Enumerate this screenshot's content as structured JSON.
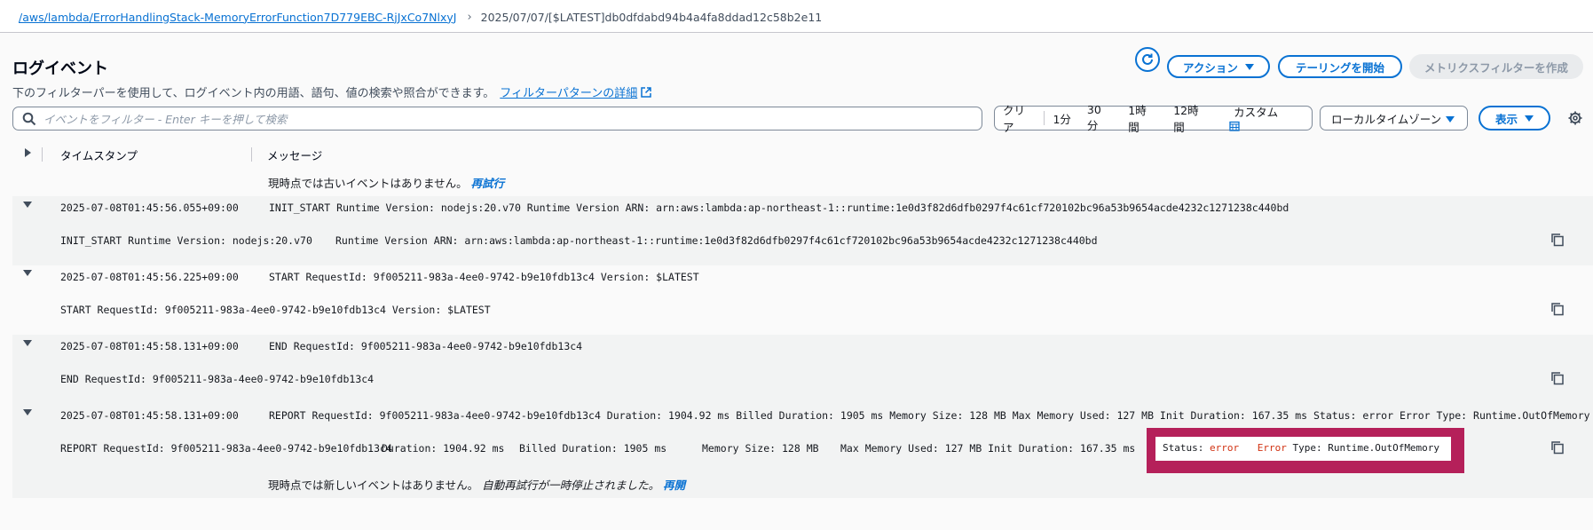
{
  "breadcrumb": {
    "link": "/aws/lambda/ErrorHandlingStack-MemoryErrorFunction7D779EBC-RjJxCo7NlxyJ",
    "current": "2025/07/07/[$LATEST]db0dfdabd94b4a4fa8ddad12c58b2e11"
  },
  "page": {
    "title": "ログイベント",
    "description": "下のフィルターパーを使用して、ログイベント内の用語、語句、値の検索や照合ができます。",
    "learn_more": "フィルターパターンの詳細"
  },
  "actions": {
    "refresh_icon": "refresh-icon",
    "actions_label": "アクション",
    "tail_label": "テーリングを開始",
    "metric_filter_label": "メトリクスフィルターを作成"
  },
  "filter": {
    "placeholder": "イベントをフィルター - Enter キーを押して検索"
  },
  "time_range": {
    "clear": "クリア",
    "options": [
      "1分",
      "30分",
      "1時間",
      "12時間"
    ],
    "custom": "カスタム"
  },
  "timezone": {
    "selected": "ローカルタイムゾーン"
  },
  "display": {
    "label": "表示"
  },
  "table": {
    "col_timestamp": "タイムスタンプ",
    "col_message": "メッセージ"
  },
  "top_notice": {
    "text": "現時点では古いイベントはありません。",
    "action": "再試行"
  },
  "bottom_notice": {
    "text": "現時点では新しいイベントはありません。",
    "paused": "自動再試行が一時停止されました。",
    "action": "再開"
  },
  "events": [
    {
      "timestamp": "2025-07-08T01:45:56.055+09:00",
      "message": "INIT_START Runtime Version: nodejs:20.v70 Runtime Version ARN: arn:aws:lambda:ap-northeast-1::runtime:1e0d3f82d6dfb0297f4c61cf720102bc96a53b9654acde4232c1271238c440bd",
      "detail_a": "INIT_START Runtime Version: nodejs:20.v70",
      "detail_b": "Runtime Version ARN: arn:aws:lambda:ap-northeast-1::runtime:1e0d3f82d6dfb0297f4c61cf720102bc96a53b9654acde4232c1271238c440bd"
    },
    {
      "timestamp": "2025-07-08T01:45:56.225+09:00",
      "message": "START RequestId: 9f005211-983a-4ee0-9742-b9e10fdb13c4 Version: $LATEST",
      "detail_a": "START RequestId: 9f005211-983a-4ee0-9742-b9e10fdb13c4 Version: $LATEST"
    },
    {
      "timestamp": "2025-07-08T01:45:58.131+09:00",
      "message": "END RequestId: 9f005211-983a-4ee0-9742-b9e10fdb13c4",
      "detail_a": "END RequestId: 9f005211-983a-4ee0-9742-b9e10fdb13c4"
    },
    {
      "timestamp": "2025-07-08T01:45:58.131+09:00",
      "message": "REPORT RequestId: 9f005211-983a-4ee0-9742-b9e10fdb13c4 Duration: 1904.92 ms Billed Duration: 1905 ms Memory Size: 128 MB Max Memory Used: 127 MB Init Duration: 167.35 ms Status: error Error Type: Runtime.OutOfMemory",
      "detail_a": "REPORT RequestId: 9f005211-983a-4ee0-9742-b9e10fdb13c4",
      "detail_b": "Duration: 1904.92 ms",
      "detail_c": "Billed Duration: 1905 ms",
      "detail_d": "Memory Size: 128 MB",
      "detail_e": "Max Memory Used: 127 MB Init Duration: 167.35 ms",
      "status_label": "Status:",
      "status_value": "error",
      "error_word": "Error",
      "error_type": "Type: Runtime.OutOfMemory"
    }
  ],
  "colors": {
    "accent": "#0972d3",
    "highlight": "#b5205a",
    "error": "#d13212"
  }
}
